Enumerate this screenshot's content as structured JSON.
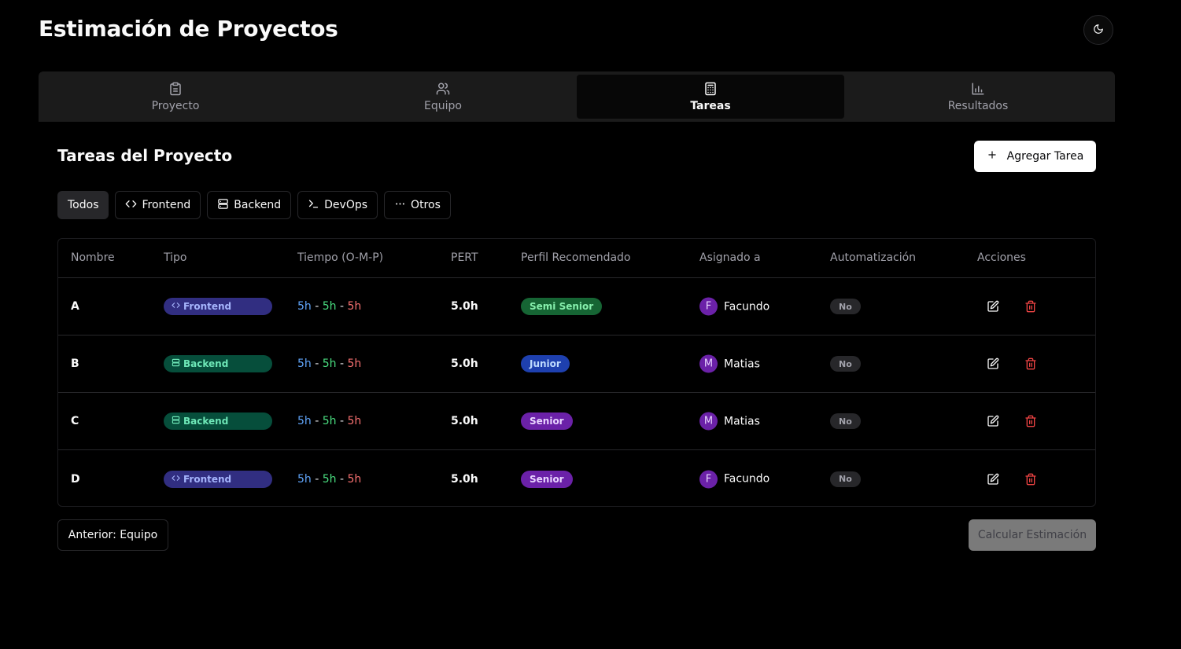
{
  "app": {
    "title": "Estimación de Proyectos"
  },
  "tabs": [
    {
      "label": "Proyecto",
      "icon": "clipboard-icon",
      "active": false
    },
    {
      "label": "Equipo",
      "icon": "users-icon",
      "active": false
    },
    {
      "label": "Tareas",
      "icon": "calculator-icon",
      "active": true
    },
    {
      "label": "Resultados",
      "icon": "bar-chart-icon",
      "active": false
    }
  ],
  "section": {
    "title": "Tareas del Proyecto",
    "add_label": "Agregar Tarea"
  },
  "filters": [
    {
      "label": "Todos",
      "icon": "",
      "active": true
    },
    {
      "label": "Frontend",
      "icon": "code-icon",
      "active": false
    },
    {
      "label": "Backend",
      "icon": "server-icon",
      "active": false
    },
    {
      "label": "DevOps",
      "icon": "terminal-icon",
      "active": false
    },
    {
      "label": "Otros",
      "icon": "more-icon",
      "active": false
    }
  ],
  "table": {
    "headers": [
      "Nombre",
      "Tipo",
      "Tiempo (O-M-P)",
      "PERT",
      "Perfil Recomendado",
      "Asignado a",
      "Automatización",
      "Acciones"
    ],
    "rows": [
      {
        "name": "A",
        "type": "Frontend",
        "o": "5h",
        "m": "5h",
        "p": "5h",
        "pert": "5.0h",
        "profile": "Semi Senior",
        "assignee": "Facundo",
        "initial": "F",
        "automation": "No"
      },
      {
        "name": "B",
        "type": "Backend",
        "o": "5h",
        "m": "5h",
        "p": "5h",
        "pert": "5.0h",
        "profile": "Junior",
        "assignee": "Matias",
        "initial": "M",
        "automation": "No"
      },
      {
        "name": "C",
        "type": "Backend",
        "o": "5h",
        "m": "5h",
        "p": "5h",
        "pert": "5.0h",
        "profile": "Senior",
        "assignee": "Matias",
        "initial": "M",
        "automation": "No"
      },
      {
        "name": "D",
        "type": "Frontend",
        "o": "5h",
        "m": "5h",
        "p": "5h",
        "pert": "5.0h",
        "profile": "Senior",
        "assignee": "Facundo",
        "initial": "F",
        "automation": "No"
      }
    ]
  },
  "footer": {
    "prev_label": "Anterior: Equipo",
    "calc_label": "Calcular Estimación"
  },
  "colors": {
    "semi_senior_bg": "#166534",
    "semi_senior_fg": "#86efac",
    "junior_bg": "#1e40af",
    "junior_fg": "#bfdbfe",
    "senior_bg": "#6b21a8",
    "senior_fg": "#e9d5ff",
    "delete_red": "#ef4444"
  }
}
